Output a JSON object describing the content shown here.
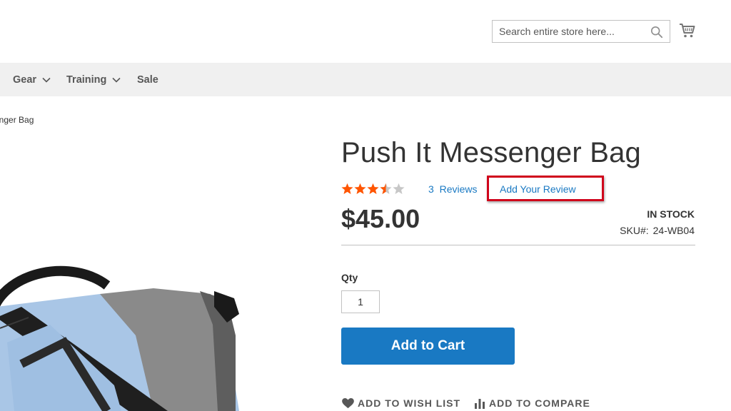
{
  "header": {
    "search_placeholder": "Search entire store here...",
    "search_icon": "search-icon",
    "cart_icon": "cart-icon"
  },
  "nav": {
    "items": [
      {
        "label": "Gear",
        "has_dropdown": true
      },
      {
        "label": "Training",
        "has_dropdown": true
      },
      {
        "label": "Sale",
        "has_dropdown": false
      }
    ]
  },
  "breadcrumb": {
    "current": "enger Bag"
  },
  "product": {
    "title": "Push It Messenger Bag",
    "rating_stars": 3.5,
    "rating_max": 5,
    "reviews_count": "3",
    "reviews_label": "Reviews",
    "add_review_label": "Add Your Review",
    "price": "$45.00",
    "stock_status": "IN STOCK",
    "sku_label": "SKU#:",
    "sku_value": "24-WB04",
    "qty_label": "Qty",
    "qty_value": "1",
    "add_to_cart_label": "Add to Cart",
    "wishlist_label": "ADD TO WISH LIST",
    "compare_label": "ADD TO COMPARE"
  },
  "colors": {
    "accent": "#1979c3",
    "star_filled": "#ff5501",
    "star_empty": "#c7c7c7",
    "highlight_box": "#d0021b",
    "nav_bg": "#f0f0f0"
  }
}
